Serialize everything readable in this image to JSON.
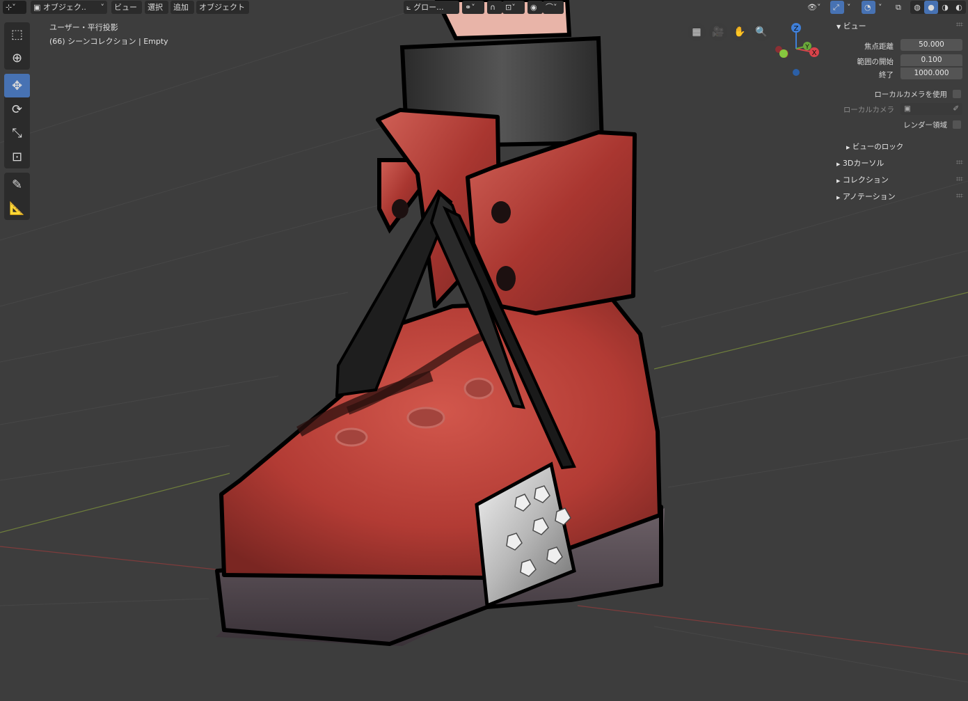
{
  "header": {
    "mode": "オブジェク..",
    "menus": [
      "ビュー",
      "選択",
      "追加",
      "オブジェクト"
    ],
    "transform_orientation": "グロー..."
  },
  "overlay": {
    "view_name": "ユーザー・平行投影",
    "collection_info": "(66) シーンコレクション | Empty"
  },
  "toolbar": {
    "tools": [
      "select-box-icon",
      "cursor-icon",
      "move-icon",
      "rotate-icon",
      "scale-icon",
      "transform-icon",
      "annotate-icon",
      "measure-icon"
    ],
    "active_tool": "move-icon"
  },
  "gizmo": {
    "z": "Z",
    "y": "Y",
    "x": "X"
  },
  "sidebar": {
    "view_panel_title": "ビュー",
    "focal_length_label": "焦点距離",
    "focal_length": "50.000",
    "clip_start_label": "範囲の開始",
    "clip_start": "0.100",
    "clip_end_label": "終了",
    "clip_end": "1000.000",
    "use_local_camera_label": "ローカルカメラを使用",
    "local_camera_label": "ローカルカメラ",
    "render_region_label": "レンダー領域",
    "view_lock_label": "ビューのロック",
    "panels": [
      "3Dカーソル",
      "コレクション",
      "アノテーション"
    ]
  },
  "colors": {
    "viewport_bg": "#3d3d3d",
    "accent": "#4772b3",
    "boot_red": "#b8413a",
    "sole": "#4a3f46"
  }
}
